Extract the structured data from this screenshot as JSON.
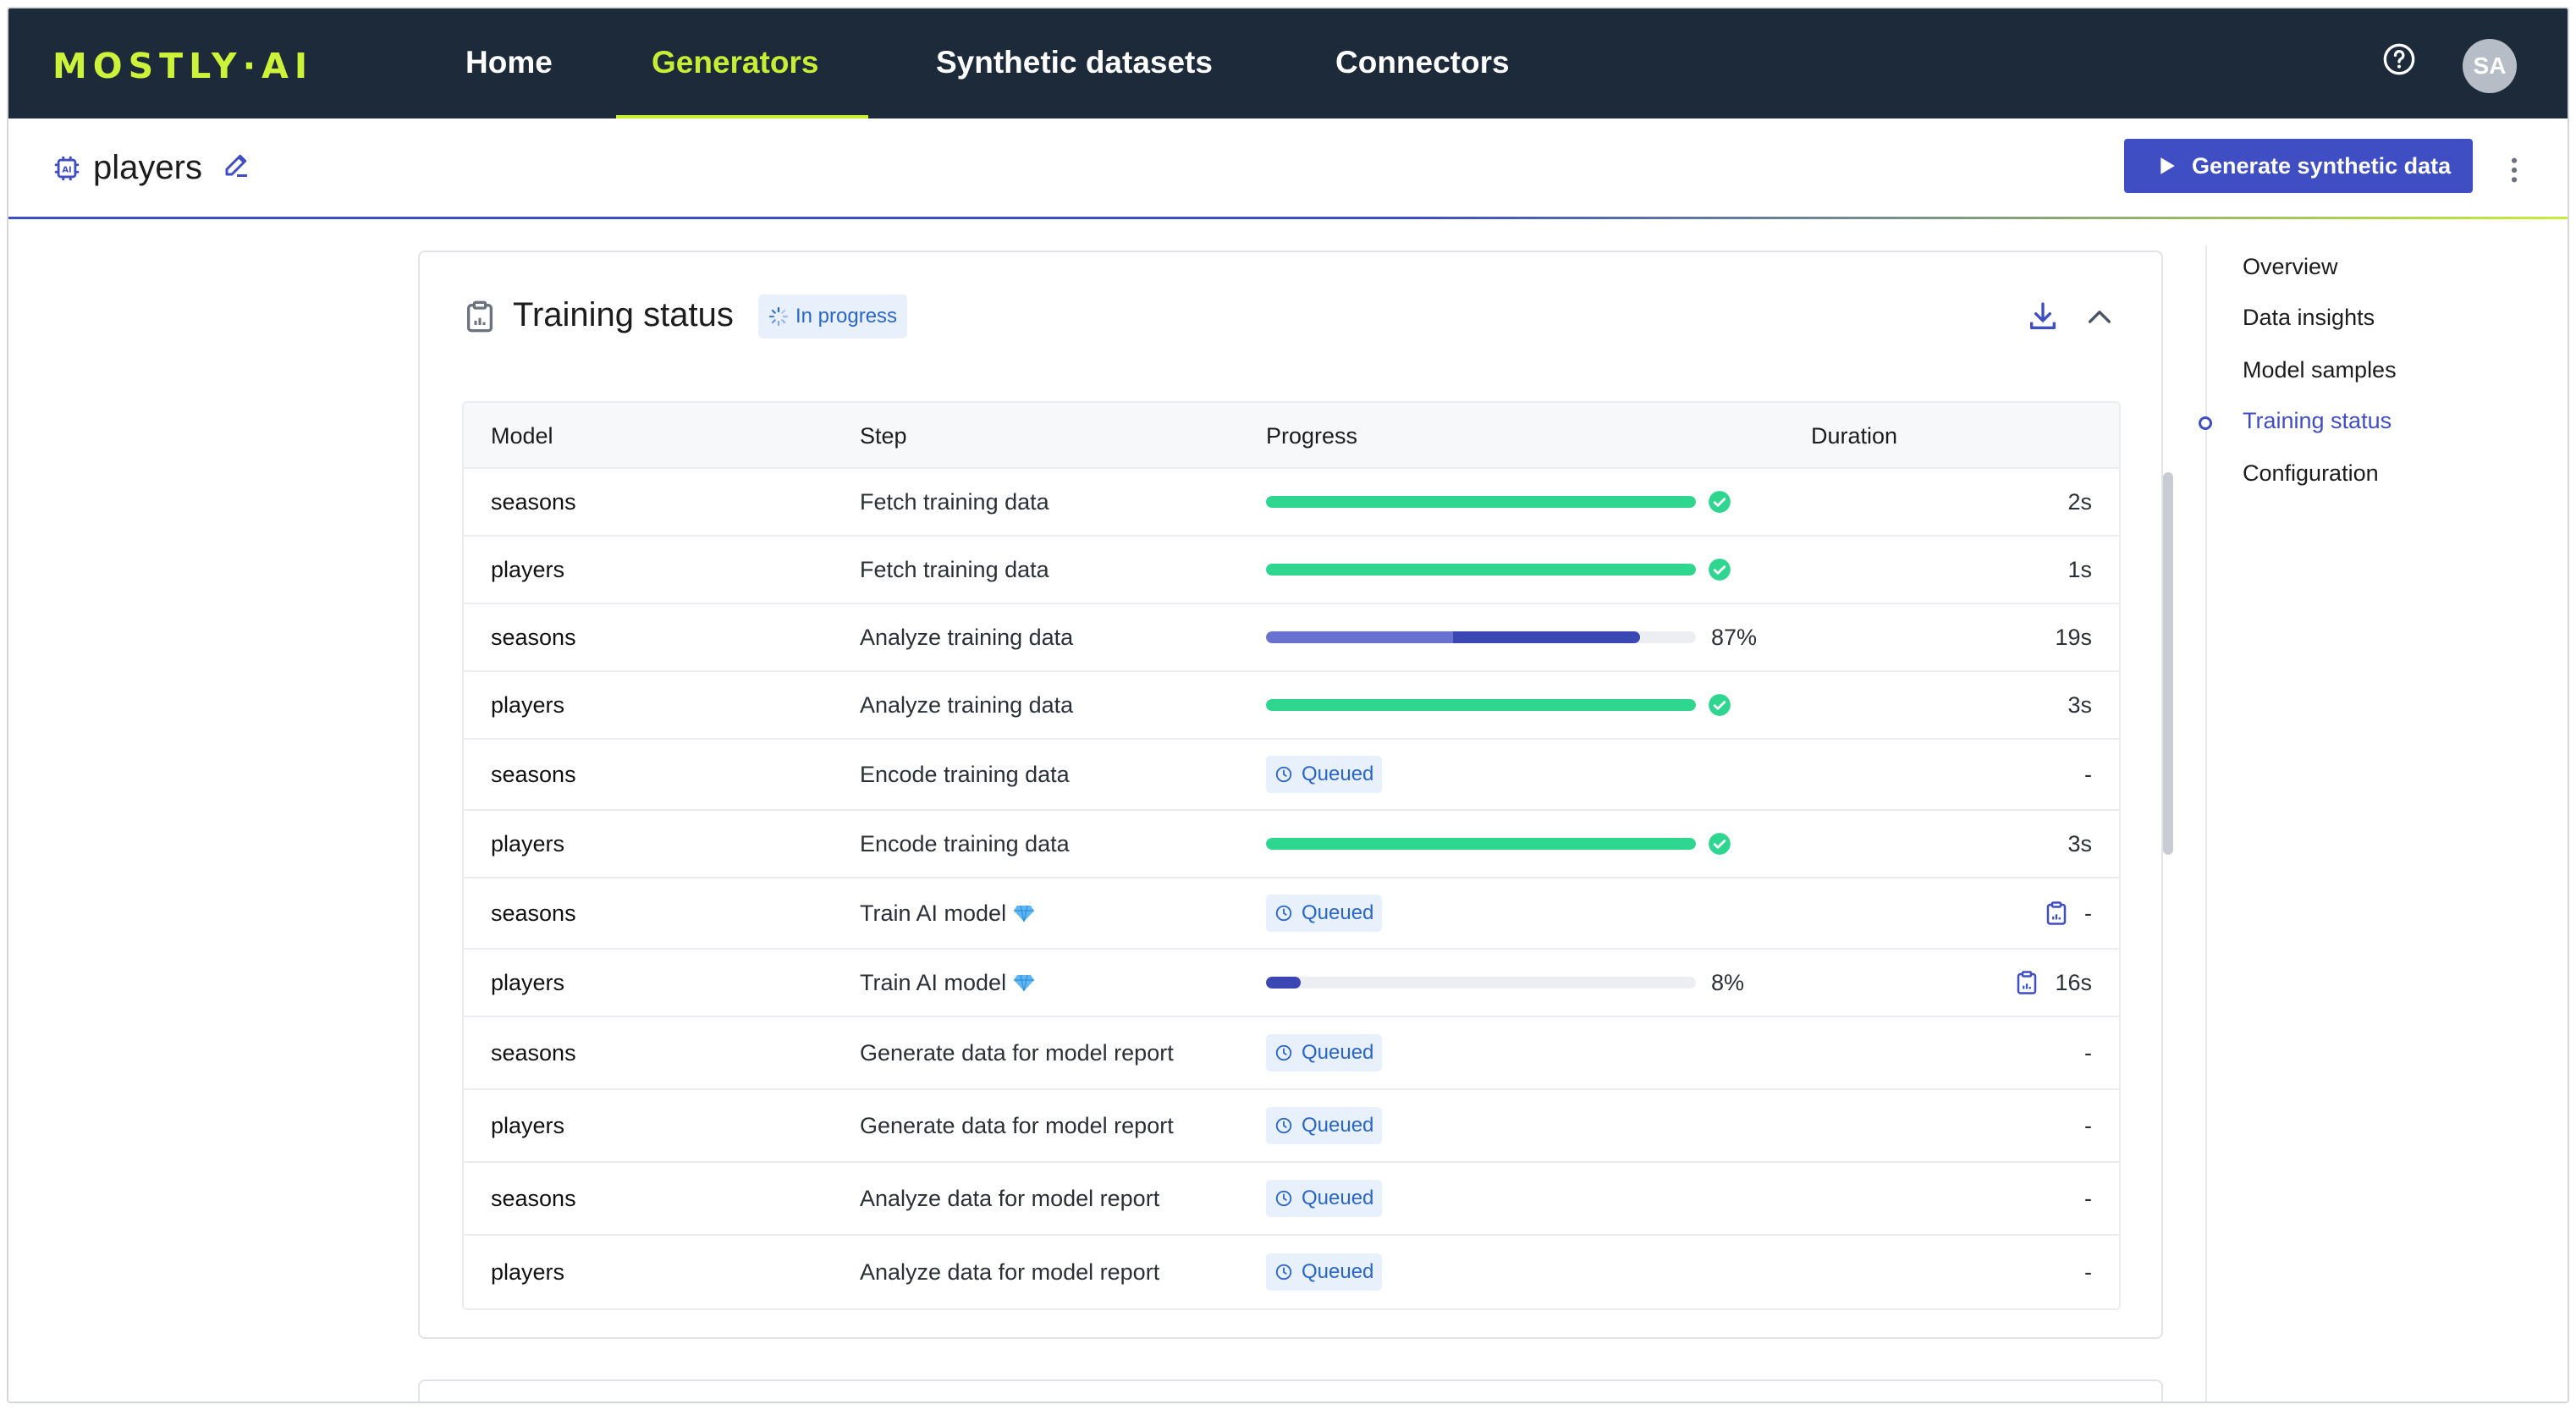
{
  "app": {
    "logo": "MOSTLY·AI",
    "nav": [
      {
        "label": "Home"
      },
      {
        "label": "Generators"
      },
      {
        "label": "Synthetic datasets"
      },
      {
        "label": "Connectors"
      }
    ],
    "active_nav": "Generators",
    "user_initials": "SA"
  },
  "header": {
    "title": "players",
    "generate_button": "Generate synthetic data"
  },
  "rail": {
    "items": [
      {
        "label": "Overview"
      },
      {
        "label": "Data insights"
      },
      {
        "label": "Model samples"
      },
      {
        "label": "Training status"
      },
      {
        "label": "Configuration"
      }
    ],
    "active": "Training status"
  },
  "training": {
    "title": "Training status",
    "status_badge": "In progress",
    "columns": {
      "model": "Model",
      "step": "Step",
      "progress": "Progress",
      "duration": "Duration"
    },
    "colors": {
      "done": "#2fd690",
      "running_light": "#6a72cf",
      "running_dark": "#3b47b3",
      "queued_text": "#2a66c9"
    },
    "rows": [
      {
        "model": "seasons",
        "step": "Fetch training data",
        "state": "done",
        "progress": 1.0,
        "duration": "2s"
      },
      {
        "model": "players",
        "step": "Fetch training data",
        "state": "done",
        "progress": 1.0,
        "duration": "1s"
      },
      {
        "model": "seasons",
        "step": "Analyze training data",
        "state": "running",
        "progress": 0.87,
        "pct": "87%",
        "duration": "19s"
      },
      {
        "model": "players",
        "step": "Analyze training data",
        "state": "done",
        "progress": 1.0,
        "duration": "3s"
      },
      {
        "model": "seasons",
        "step": "Encode training data",
        "state": "queued",
        "queued_label": "Queued",
        "duration": "-"
      },
      {
        "model": "players",
        "step": "Encode training data",
        "state": "done",
        "progress": 1.0,
        "duration": "3s"
      },
      {
        "model": "seasons",
        "step": "Train AI model",
        "state": "queued",
        "queued_label": "Queued",
        "duration": "-",
        "diamond": true,
        "report": true
      },
      {
        "model": "players",
        "step": "Train AI model",
        "state": "running",
        "progress": 0.08,
        "pct": "8%",
        "duration": "16s",
        "diamond": true,
        "report": true
      },
      {
        "model": "seasons",
        "step": "Generate data for model report",
        "state": "queued",
        "queued_label": "Queued",
        "duration": "-"
      },
      {
        "model": "players",
        "step": "Generate data for model report",
        "state": "queued",
        "queued_label": "Queued",
        "duration": "-"
      },
      {
        "model": "seasons",
        "step": "Analyze data for model report",
        "state": "queued",
        "queued_label": "Queued",
        "duration": "-"
      },
      {
        "model": "players",
        "step": "Analyze data for model report",
        "state": "queued",
        "queued_label": "Queued",
        "duration": "-"
      }
    ]
  }
}
